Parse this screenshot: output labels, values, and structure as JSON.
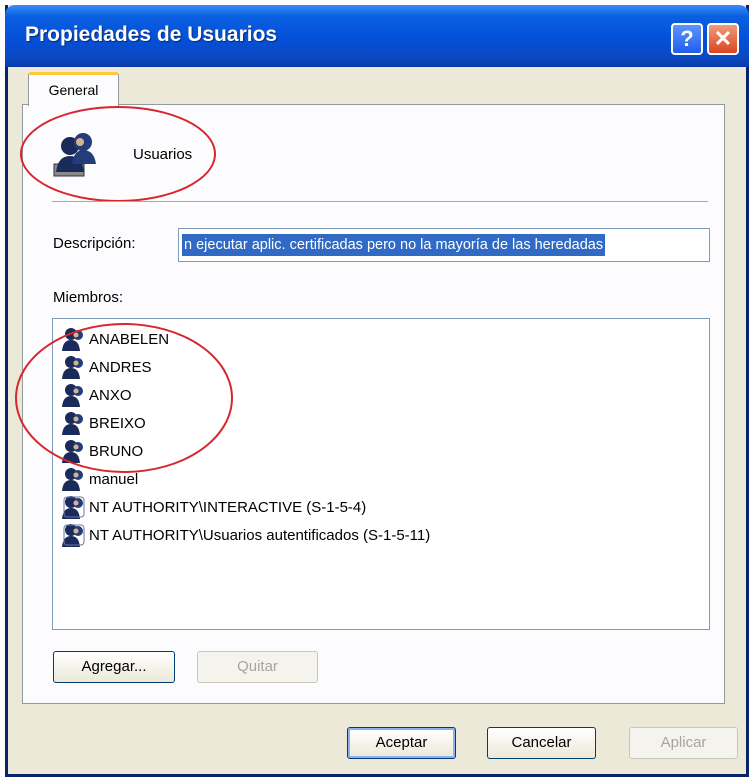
{
  "window": {
    "title": "Propiedades de Usuarios",
    "help_glyph": "?",
    "close_glyph": "✕"
  },
  "tabs": [
    {
      "label": "General"
    }
  ],
  "group": {
    "name": "Usuarios",
    "icon": "users-group-icon"
  },
  "description": {
    "label": "Descripción:",
    "value": "n ejecutar aplic. certificadas pero no la mayoría de las heredadas"
  },
  "members": {
    "label": "Miembros:",
    "items": [
      {
        "name": "ANABELEN",
        "icon": "user-icon"
      },
      {
        "name": "ANDRES",
        "icon": "user-icon"
      },
      {
        "name": "ANXO",
        "icon": "user-icon"
      },
      {
        "name": "BREIXO",
        "icon": "user-icon"
      },
      {
        "name": "BRUNO",
        "icon": "user-icon"
      },
      {
        "name": "manuel",
        "icon": "user-icon"
      },
      {
        "name": "NT AUTHORITY\\INTERACTIVE (S-1-5-4)",
        "icon": "well-known-group-icon"
      },
      {
        "name": "NT AUTHORITY\\Usuarios autentificados (S-1-5-11)",
        "icon": "well-known-group-icon"
      }
    ]
  },
  "buttons": {
    "add": "Agregar...",
    "remove": "Quitar",
    "ok": "Aceptar",
    "cancel": "Cancelar",
    "apply": "Aplicar"
  },
  "colors": {
    "annotation_red": "#d7262e",
    "selection_blue": "#316ac5",
    "title_blue": "#0550d8"
  }
}
